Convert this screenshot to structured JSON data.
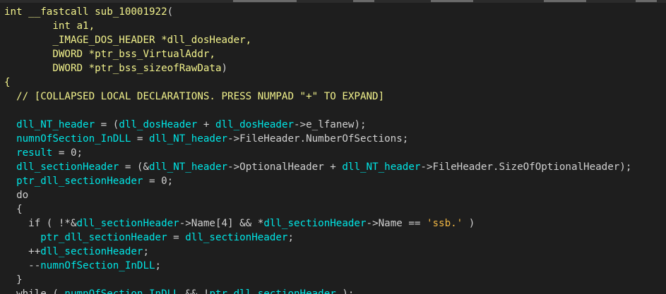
{
  "colors": {
    "background": "#1e1e1e",
    "keyword_yellow": "#f2f28c",
    "identifier_light": "#d0d0d0",
    "global_cyan": "#00e6e6",
    "string_orange": "#f2b844"
  },
  "code": {
    "lines": [
      [
        [
          "k",
          "int __fastcall sub_10001922"
        ],
        [
          "p",
          "("
        ]
      ],
      [
        [
          "p",
          "        "
        ],
        [
          "k",
          "int a1,"
        ]
      ],
      [
        [
          "p",
          "        "
        ],
        [
          "k",
          "_IMAGE_DOS_HEADER *dll_dosHeader,"
        ]
      ],
      [
        [
          "p",
          "        "
        ],
        [
          "k",
          "DWORD *ptr_bss_VirtualAddr,"
        ]
      ],
      [
        [
          "p",
          "        "
        ],
        [
          "k",
          "DWORD *ptr_bss_sizeofRawData"
        ],
        [
          "p",
          ")"
        ]
      ],
      [
        [
          "k",
          "{"
        ]
      ],
      [
        [
          "p",
          "  "
        ],
        [
          "c",
          "// [COLLAPSED LOCAL DECLARATIONS. PRESS NUMPAD \"+\" TO EXPAND]"
        ]
      ],
      [
        [
          "p",
          ""
        ]
      ],
      [
        [
          "p",
          "  "
        ],
        [
          "g",
          "dll_NT_header"
        ],
        [
          "p",
          " = ("
        ],
        [
          "g",
          "dll_dosHeader"
        ],
        [
          "p",
          " + "
        ],
        [
          "g",
          "dll_dosHeader"
        ],
        [
          "p",
          "->e_lfanew);"
        ]
      ],
      [
        [
          "p",
          "  "
        ],
        [
          "g",
          "numnOfSection_InDLL"
        ],
        [
          "p",
          " = "
        ],
        [
          "g",
          "dll_NT_header"
        ],
        [
          "p",
          "->FileHeader.NumberOfSections;"
        ]
      ],
      [
        [
          "p",
          "  "
        ],
        [
          "g",
          "result"
        ],
        [
          "p",
          " = 0;"
        ]
      ],
      [
        [
          "p",
          "  "
        ],
        [
          "g",
          "dll_sectionHeader"
        ],
        [
          "p",
          " = (&"
        ],
        [
          "g",
          "dll_NT_header"
        ],
        [
          "p",
          "->OptionalHeader + "
        ],
        [
          "g",
          "dll_NT_header"
        ],
        [
          "p",
          "->FileHeader.SizeOfOptionalHeader);"
        ]
      ],
      [
        [
          "p",
          "  "
        ],
        [
          "g",
          "ptr_dll_sectionHeader"
        ],
        [
          "p",
          " = 0;"
        ]
      ],
      [
        [
          "p",
          "  do"
        ]
      ],
      [
        [
          "p",
          "  {"
        ]
      ],
      [
        [
          "p",
          "    if ( !*&"
        ],
        [
          "g",
          "dll_sectionHeader"
        ],
        [
          "p",
          "->Name[4] && *"
        ],
        [
          "g",
          "dll_sectionHeader"
        ],
        [
          "p",
          "->Name == "
        ],
        [
          "s",
          "'ssb.'"
        ],
        [
          "p",
          " )"
        ]
      ],
      [
        [
          "p",
          "      "
        ],
        [
          "g",
          "ptr_dll_sectionHeader"
        ],
        [
          "p",
          " = "
        ],
        [
          "g",
          "dll_sectionHeader"
        ],
        [
          "p",
          ";"
        ]
      ],
      [
        [
          "p",
          "    ++"
        ],
        [
          "g",
          "dll_sectionHeader"
        ],
        [
          "p",
          ";"
        ]
      ],
      [
        [
          "p",
          "    --"
        ],
        [
          "g",
          "numnOfSection_InDLL"
        ],
        [
          "p",
          ";"
        ]
      ],
      [
        [
          "p",
          "  }"
        ]
      ],
      [
        [
          "p",
          "  while ( "
        ],
        [
          "g",
          "numnOfSection_InDLL"
        ],
        [
          "p",
          " && !"
        ],
        [
          "g",
          "ptr_dll_sectionHeader"
        ],
        [
          "p",
          " );"
        ]
      ]
    ]
  }
}
